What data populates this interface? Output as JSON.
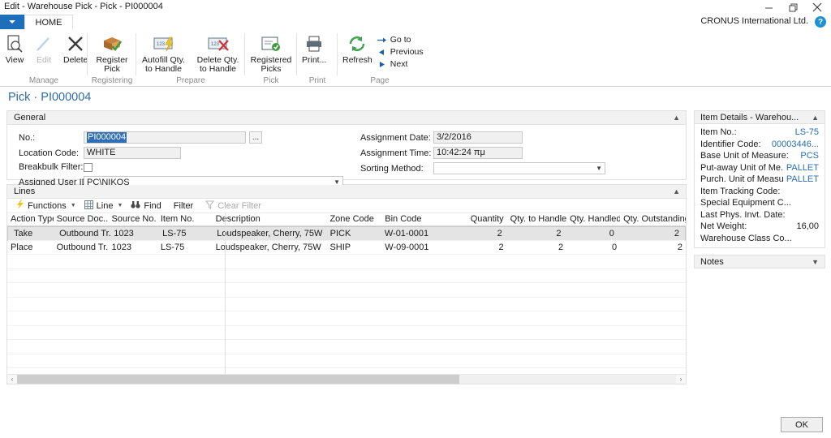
{
  "window": {
    "title": "Edit - Warehouse Pick - Pick - PI000004",
    "company": "CRONUS International Ltd.",
    "minimize_icon": "minimize-icon",
    "restore_icon": "restore-icon",
    "close_icon": "close-icon",
    "help_icon": "help-icon",
    "help_label": "?"
  },
  "ribbon": {
    "app_menu_label": "",
    "tabs": [
      {
        "label": "HOME"
      }
    ],
    "groups": [
      {
        "name": "Manage",
        "buttons": [
          {
            "label": "View",
            "icon": "view-magnifier-icon",
            "disabled": false
          },
          {
            "label": "Edit",
            "icon": "edit-pencil-icon",
            "disabled": true
          },
          {
            "label": "Delete",
            "icon": "delete-x-icon",
            "disabled": false
          }
        ]
      },
      {
        "name": "Registering",
        "buttons": [
          {
            "label": "Register Pick",
            "icon": "register-pick-box-icon",
            "disabled": false
          }
        ]
      },
      {
        "name": "Prepare",
        "buttons": [
          {
            "label": "Autofill Qty. to Handle",
            "icon": "autofill-lightning-icon",
            "disabled": false
          },
          {
            "label": "Delete Qty. to Handle",
            "icon": "delete-qty-red-x-icon",
            "disabled": false
          }
        ]
      },
      {
        "name": "Pick",
        "buttons": [
          {
            "label": "Registered Picks",
            "icon": "registered-picks-check-icon",
            "disabled": false
          }
        ]
      },
      {
        "name": "Print",
        "buttons": [
          {
            "label": "Print...",
            "icon": "printer-icon",
            "disabled": false
          }
        ]
      },
      {
        "name": "Page",
        "buttons": [
          {
            "label": "Refresh",
            "icon": "refresh-circular-arrows-icon",
            "disabled": false
          }
        ],
        "links": [
          {
            "label": "Go to",
            "icon": "arrow-right-icon"
          },
          {
            "label": "Previous",
            "icon": "arrow-left-triangle-icon"
          },
          {
            "label": "Next",
            "icon": "arrow-right-triangle-icon"
          }
        ]
      }
    ]
  },
  "page": {
    "title": "Pick · PI000004"
  },
  "general": {
    "header": "General",
    "collapse_icon": "chevron-up-icon",
    "fields": {
      "no_label": "No.:",
      "no_value": "PI000004",
      "no_lookup_label": "...",
      "location_label": "Location Code:",
      "location_value": "WHITE",
      "breakbulk_label": "Breakbulk Filter:",
      "breakbulk_checked": false,
      "assigned_user_label": "Assigned User ID:",
      "assigned_user_value": "PC\\NIKOS",
      "assignment_date_label": "Assignment Date:",
      "assignment_date_value": "3/2/2016",
      "assignment_time_label": "Assignment Time:",
      "assignment_time_value": "10:42:24 πμ",
      "sorting_method_label": "Sorting Method:",
      "sorting_method_value": ""
    }
  },
  "lines": {
    "header": "Lines",
    "collapse_icon": "chevron-up-icon",
    "toolbar": [
      {
        "label": "Functions",
        "icon": "lightning-bolt-icon",
        "caret": true,
        "dim": false
      },
      {
        "label": "Line",
        "icon": "grid-lines-icon",
        "caret": true,
        "dim": false
      },
      {
        "label": "Find",
        "icon": "binoculars-icon",
        "caret": false,
        "dim": false
      },
      {
        "label": "Filter",
        "icon": "",
        "caret": false,
        "dim": false
      },
      {
        "label": "Clear Filter",
        "icon": "clear-filter-icon",
        "caret": false,
        "dim": true
      }
    ],
    "columns": [
      {
        "key": "action_type",
        "label": "Action Type",
        "width": 60,
        "align": "left"
      },
      {
        "key": "source_doc",
        "label": "Source Doc...",
        "width": 72,
        "align": "left"
      },
      {
        "key": "source_no",
        "label": "Source No.",
        "width": 64,
        "align": "left"
      },
      {
        "key": "item_no",
        "label": "Item No.",
        "width": 72,
        "align": "left"
      },
      {
        "key": "description",
        "label": "Description",
        "width": 150,
        "align": "left"
      },
      {
        "key": "zone_code",
        "label": "Zone Code",
        "width": 72,
        "align": "left"
      },
      {
        "key": "bin_code",
        "label": "Bin Code",
        "width": 96,
        "align": "left"
      },
      {
        "key": "quantity",
        "label": "Quantity",
        "width": 68,
        "align": "right"
      },
      {
        "key": "qty_to_handle",
        "label": "Qty. to Handle",
        "width": 78,
        "align": "right"
      },
      {
        "key": "qty_handled",
        "label": "Qty. Handled",
        "width": 70,
        "align": "right"
      },
      {
        "key": "qty_outstanding",
        "label": "Qty. Outstanding",
        "width": 86,
        "align": "right"
      }
    ],
    "rows": [
      {
        "selected": true,
        "action_type": "Take",
        "source_doc": "Outbound Tr...",
        "source_no": "1023",
        "item_no": "LS-75",
        "description": "Loudspeaker, Cherry, 75W",
        "zone_code": "PICK",
        "bin_code": "W-01-0001",
        "quantity": "2",
        "qty_to_handle": "2",
        "qty_handled": "0",
        "qty_outstanding": "2"
      },
      {
        "selected": false,
        "action_type": "Place",
        "source_doc": "Outbound Tr...",
        "source_no": "1023",
        "item_no": "LS-75",
        "description": "Loudspeaker, Cherry, 75W",
        "zone_code": "SHIP",
        "bin_code": "W-09-0001",
        "quantity": "2",
        "qty_to_handle": "2",
        "qty_handled": "0",
        "qty_outstanding": "2"
      }
    ],
    "empty_row_count": 9,
    "scrollbar": {
      "left_arrow": "‹",
      "right_arrow": "›"
    }
  },
  "factbox": {
    "title": "Item Details - Warehou...",
    "collapse_icon": "chevron-up-icon",
    "rows": [
      {
        "key": "Item No.:",
        "value": "LS-75",
        "link": true
      },
      {
        "key": "Identifier Code:",
        "value": "00003446...",
        "link": true
      },
      {
        "key": "Base Unit of Measure:",
        "value": "PCS",
        "link": true
      },
      {
        "key": "Put-away Unit of Me...",
        "value": "PALLET",
        "link": true
      },
      {
        "key": "Purch. Unit of Measu...",
        "value": "PALLET",
        "link": true
      },
      {
        "key": "Item Tracking Code:",
        "value": "",
        "link": true
      },
      {
        "key": "Special Equipment C...",
        "value": "",
        "link": true
      },
      {
        "key": "Last Phys. Invt. Date:",
        "value": "",
        "link": true
      },
      {
        "key": "Net Weight:",
        "value": "16,00",
        "link": false
      },
      {
        "key": "Warehouse Class Co...",
        "value": "",
        "link": true
      }
    ],
    "notes": {
      "title": "Notes",
      "expand_icon": "chevron-down-icon"
    }
  },
  "footer": {
    "ok_label": "OK"
  },
  "colors": {
    "accent_blue": "#1e6fba",
    "title_blue": "#2e6ca3",
    "link_blue": "#2a6db0",
    "selection_blue": "#2f6fb5",
    "row_selected": "#e4e4e4"
  }
}
